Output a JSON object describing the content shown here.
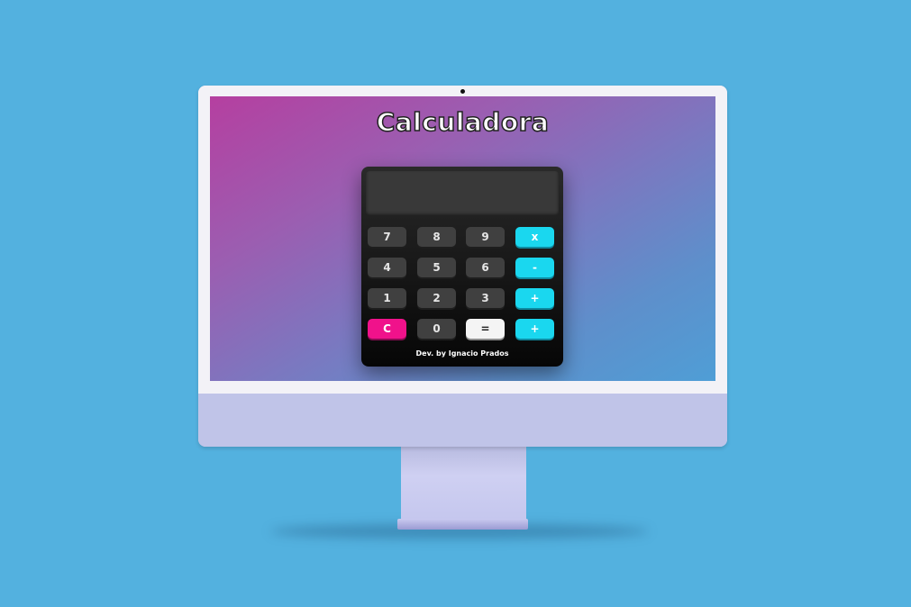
{
  "app": {
    "title": "Calculadora",
    "display_value": "",
    "credit": "Dev. by Ignacio Prados"
  },
  "keypad": {
    "rows": [
      [
        "7",
        "8",
        "9",
        "x"
      ],
      [
        "4",
        "5",
        "6",
        "-"
      ],
      [
        "1",
        "2",
        "3",
        "+"
      ],
      [
        "C",
        "0",
        "=",
        "+"
      ]
    ]
  },
  "colors": {
    "background": "#53b1df",
    "operator_key": "#1ad7ef",
    "clear_key": "#f0128b",
    "equals_key": "#f4f4f4",
    "digit_key": "#404040",
    "calculator_body": "#111111"
  },
  "icons": {
    "camera": "camera-dot-icon"
  }
}
